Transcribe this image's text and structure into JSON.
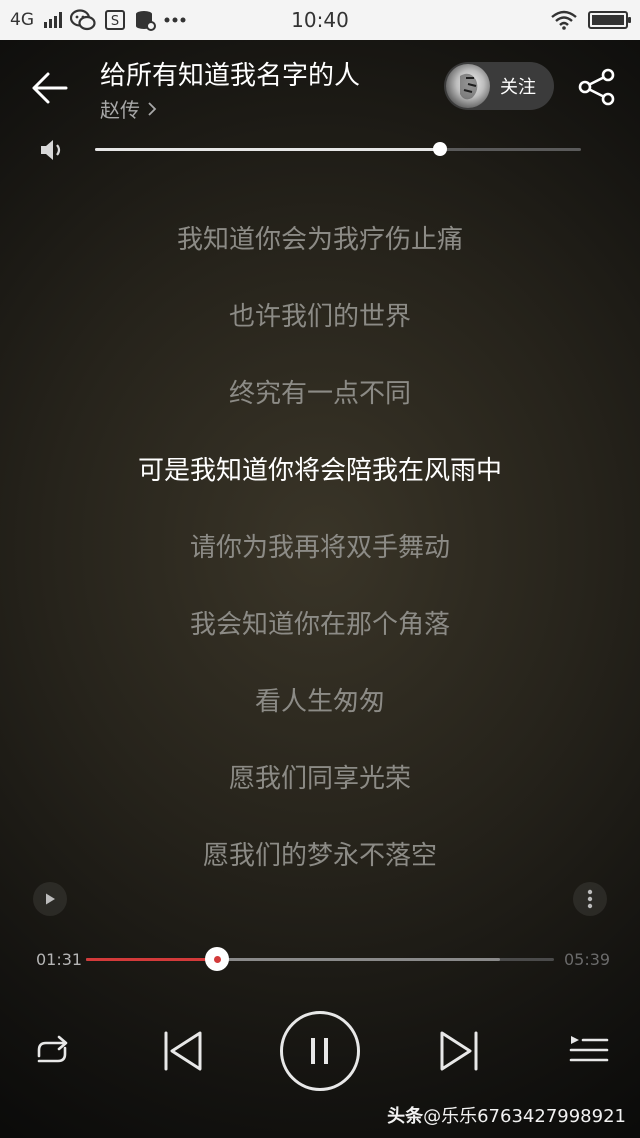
{
  "status_bar": {
    "network": "4G",
    "time": "10:40",
    "icons": [
      "signal-icon",
      "wechat-icon",
      "s-app-icon",
      "database-icon",
      "more-dots-icon",
      "wifi-icon",
      "battery-icon"
    ]
  },
  "header": {
    "song_title": "给所有知道我名字的人",
    "artist": "赵传",
    "follow_label": "关注"
  },
  "volume": {
    "level": 0.71
  },
  "lyrics": {
    "lines": [
      "我知道你会为我疗伤止痛",
      "也许我们的世界",
      "终究有一点不同",
      "可是我知道你将会陪我在风雨中",
      "请你为我再将双手舞动",
      "我会知道你在那个角落",
      "看人生匆匆",
      "愿我们同享光荣",
      "愿我们的梦永不落空"
    ],
    "current_index": 3
  },
  "progress": {
    "current_time": "01:31",
    "total_time": "05:39",
    "played_fraction": 0.28,
    "buffered_fraction": 0.885
  },
  "colors": {
    "accent": "#d33a3a",
    "lyric_dim": "#8c8b86",
    "lyric_active": "#ffffff"
  },
  "watermark": {
    "brand": "头条",
    "handle": "@乐乐6763427998921"
  }
}
